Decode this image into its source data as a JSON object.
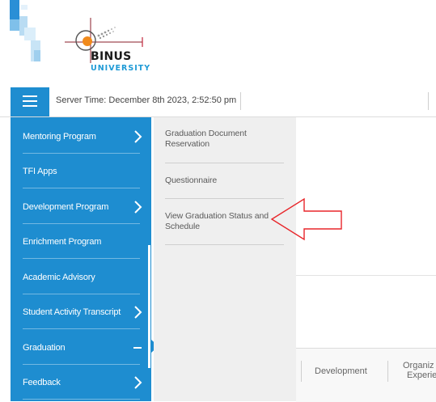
{
  "brand": {
    "name": "BINUS",
    "subtitle": "UNIVERSITY",
    "accent_color": "#1e8dd0",
    "secondary_color": "#1e9ad6",
    "logo_dot_color": "#f08a1c"
  },
  "topbar": {
    "menu_icon": "hamburger-icon",
    "server_time": "Server Time: December 8th 2023, 2:52:50 pm"
  },
  "sidebar": {
    "items": [
      {
        "label": "Mentoring Program",
        "indicator": "chevron-right-icon"
      },
      {
        "label": "TFI Apps",
        "indicator": ""
      },
      {
        "label": "Development Program",
        "indicator": "chevron-right-icon"
      },
      {
        "label": "Enrichment Program",
        "indicator": ""
      },
      {
        "label": "Academic Advisory",
        "indicator": ""
      },
      {
        "label": "Student Activity Transcript",
        "indicator": "chevron-right-icon"
      },
      {
        "label": "Graduation",
        "indicator": "minus-icon",
        "expanded": true
      },
      {
        "label": "Feedback",
        "indicator": "chevron-right-icon"
      }
    ]
  },
  "submenu": {
    "items": [
      {
        "label": "Graduation Document Reservation"
      },
      {
        "label": "Questionnaire"
      },
      {
        "label": "View Graduation Status and Schedule",
        "highlighted_by_annotation": true
      }
    ]
  },
  "bottom_tabs": {
    "development": "Development",
    "organiz_line1": "Organiz",
    "organiz_line2": "Experie"
  },
  "annotation": {
    "arrow_color": "#e8262a",
    "points_to": "View Graduation Status and Schedule"
  }
}
